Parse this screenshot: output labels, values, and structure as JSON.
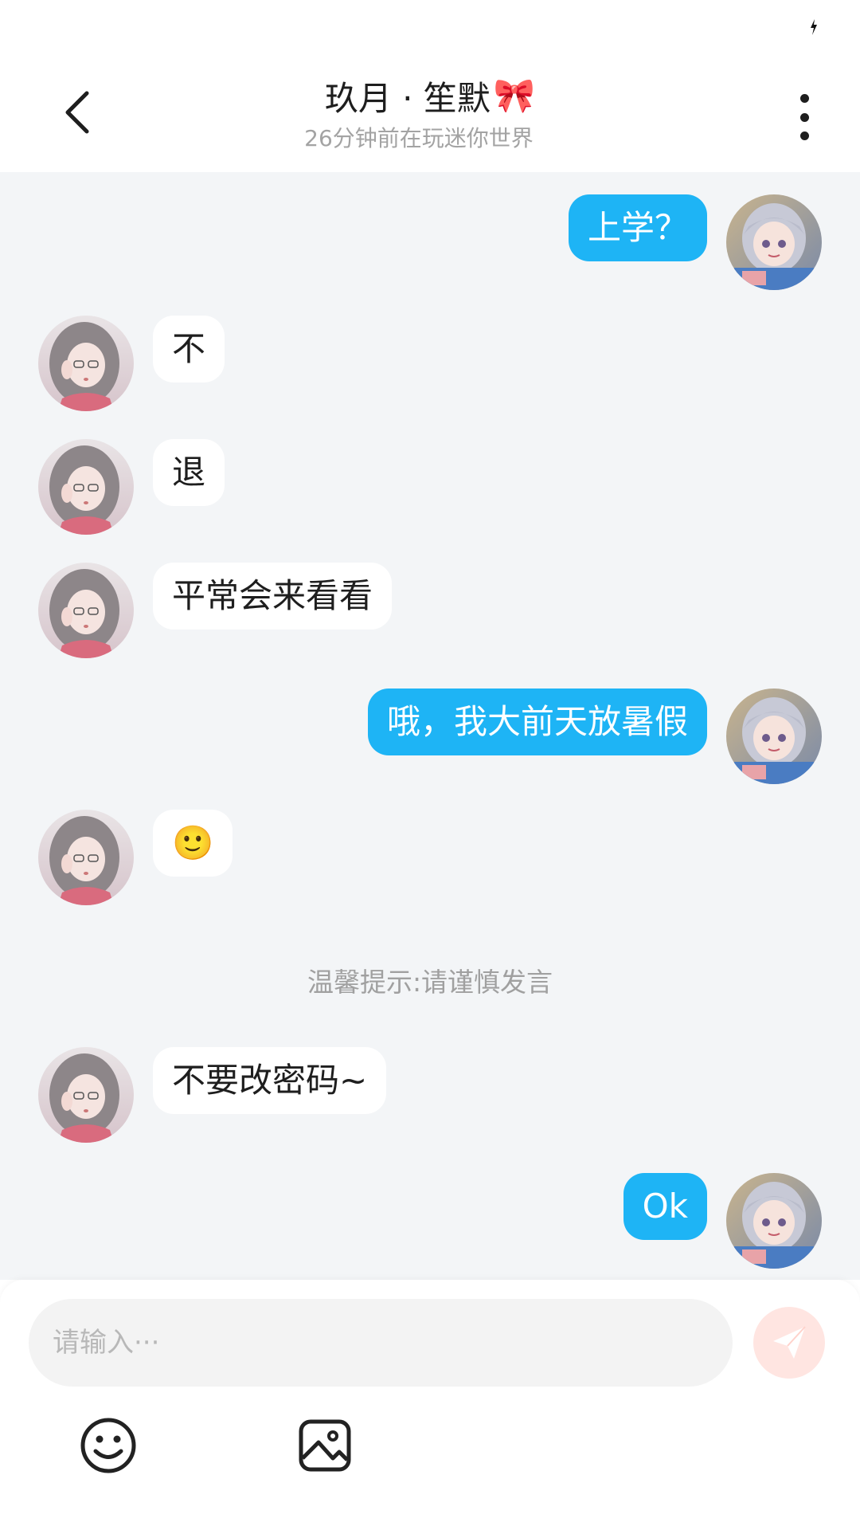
{
  "header": {
    "title": "玖月 · 笙默",
    "title_emoji": "🎀",
    "subtitle": "26分钟前在玩迷你世界"
  },
  "colors": {
    "outgoing_bubble": "#1eb4f5",
    "incoming_bubble": "#ffffff",
    "chat_background": "#f3f5f7",
    "send_button": "#ffe5e1"
  },
  "messages": [
    {
      "side": "out",
      "text": "上学？"
    },
    {
      "side": "in",
      "text": "不"
    },
    {
      "side": "in",
      "text": "退"
    },
    {
      "side": "in",
      "text": "平常会来看看"
    },
    {
      "side": "out",
      "text": "哦，我大前天放暑假"
    },
    {
      "side": "in",
      "text": "🙂"
    },
    {
      "side": "in",
      "text": "不要改密码~"
    },
    {
      "side": "out",
      "text": "Ok"
    }
  ],
  "notice": "温馨提示:请谨慎发言",
  "composer": {
    "placeholder": "请输入···",
    "value": ""
  },
  "icons": {
    "back": "chevron-left-icon",
    "more": "more-vertical-icon",
    "send": "paper-plane-icon",
    "emoji": "smiley-icon",
    "image": "image-icon"
  }
}
